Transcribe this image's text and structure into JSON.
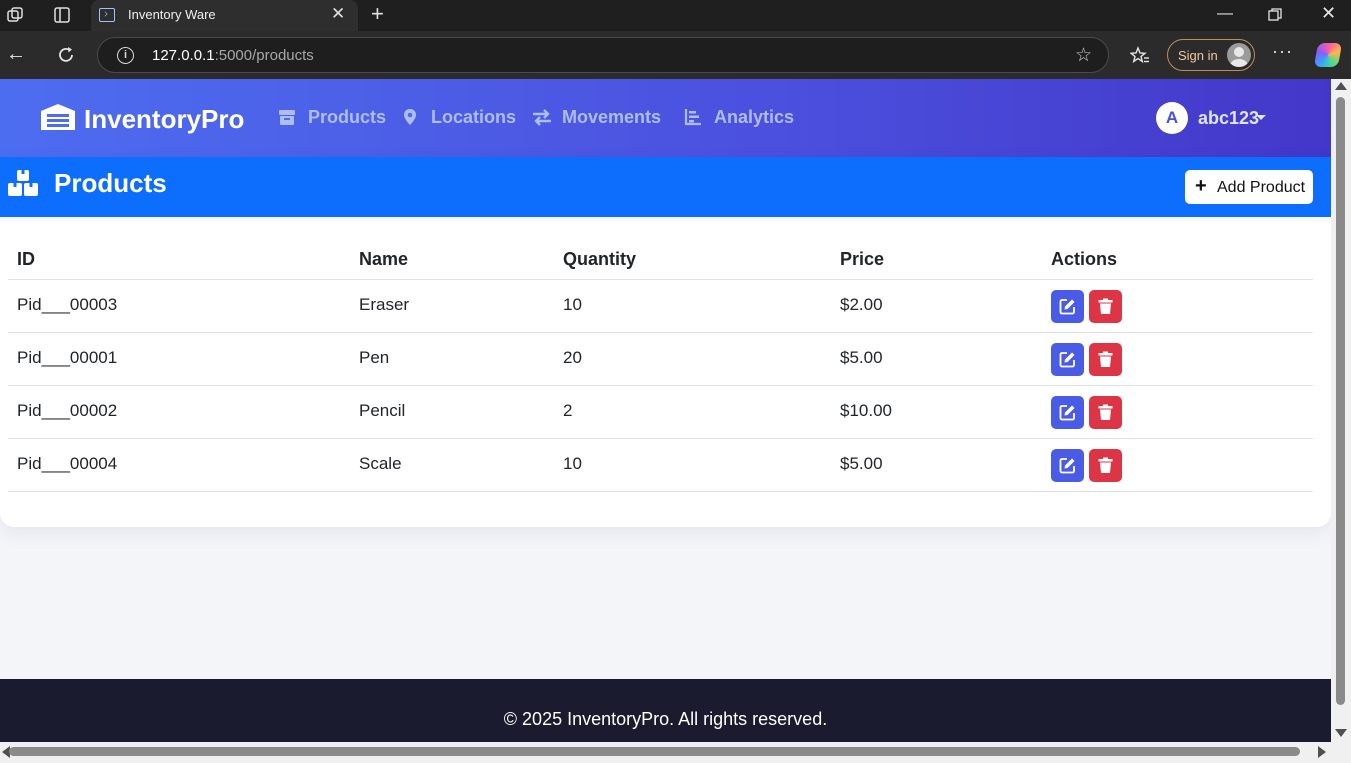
{
  "browser": {
    "tab_title": "Inventory Ware",
    "url_host": "127.0.0.1",
    "url_path": ":5000/products",
    "sign_in_label": "Sign in",
    "icons": [
      "workspaces-icon",
      "tab-actions-icon",
      "back-icon",
      "refresh-icon",
      "site-info-icon",
      "favorite-star-icon",
      "favorites-icon",
      "more-icon",
      "copilot-icon",
      "minimize-icon",
      "restore-icon",
      "close-window-icon"
    ]
  },
  "navbar": {
    "brand": "InventoryPro",
    "items": [
      {
        "label": "Products",
        "icon": "box-icon"
      },
      {
        "label": "Locations",
        "icon": "map-pin-icon"
      },
      {
        "label": "Movements",
        "icon": "exchange-icon"
      },
      {
        "label": "Analytics",
        "icon": "chart-icon"
      }
    ],
    "user": {
      "initial": "A",
      "name": "abc123"
    }
  },
  "products_card": {
    "title": "Products",
    "add_button_label": "Add Product",
    "columns": [
      "ID",
      "Name",
      "Quantity",
      "Price",
      "Actions"
    ],
    "rows": [
      {
        "id": "Pid___00003",
        "name": "Eraser",
        "quantity": "10",
        "price": "$2.00"
      },
      {
        "id": "Pid___00001",
        "name": "Pen",
        "quantity": "20",
        "price": "$5.00"
      },
      {
        "id": "Pid___00002",
        "name": "Pencil",
        "quantity": "2",
        "price": "$10.00"
      },
      {
        "id": "Pid___00004",
        "name": "Scale",
        "quantity": "10",
        "price": "$5.00"
      }
    ]
  },
  "footer": {
    "text": "© 2025 InventoryPro. All rights reserved."
  },
  "colors": {
    "navbar_start": "#4d6df0",
    "navbar_end": "#4337c9",
    "card_header": "#0d6efd",
    "edit_button": "#4a5ce6",
    "delete_button": "#dc3545",
    "footer_bg": "#1a1b2e"
  }
}
